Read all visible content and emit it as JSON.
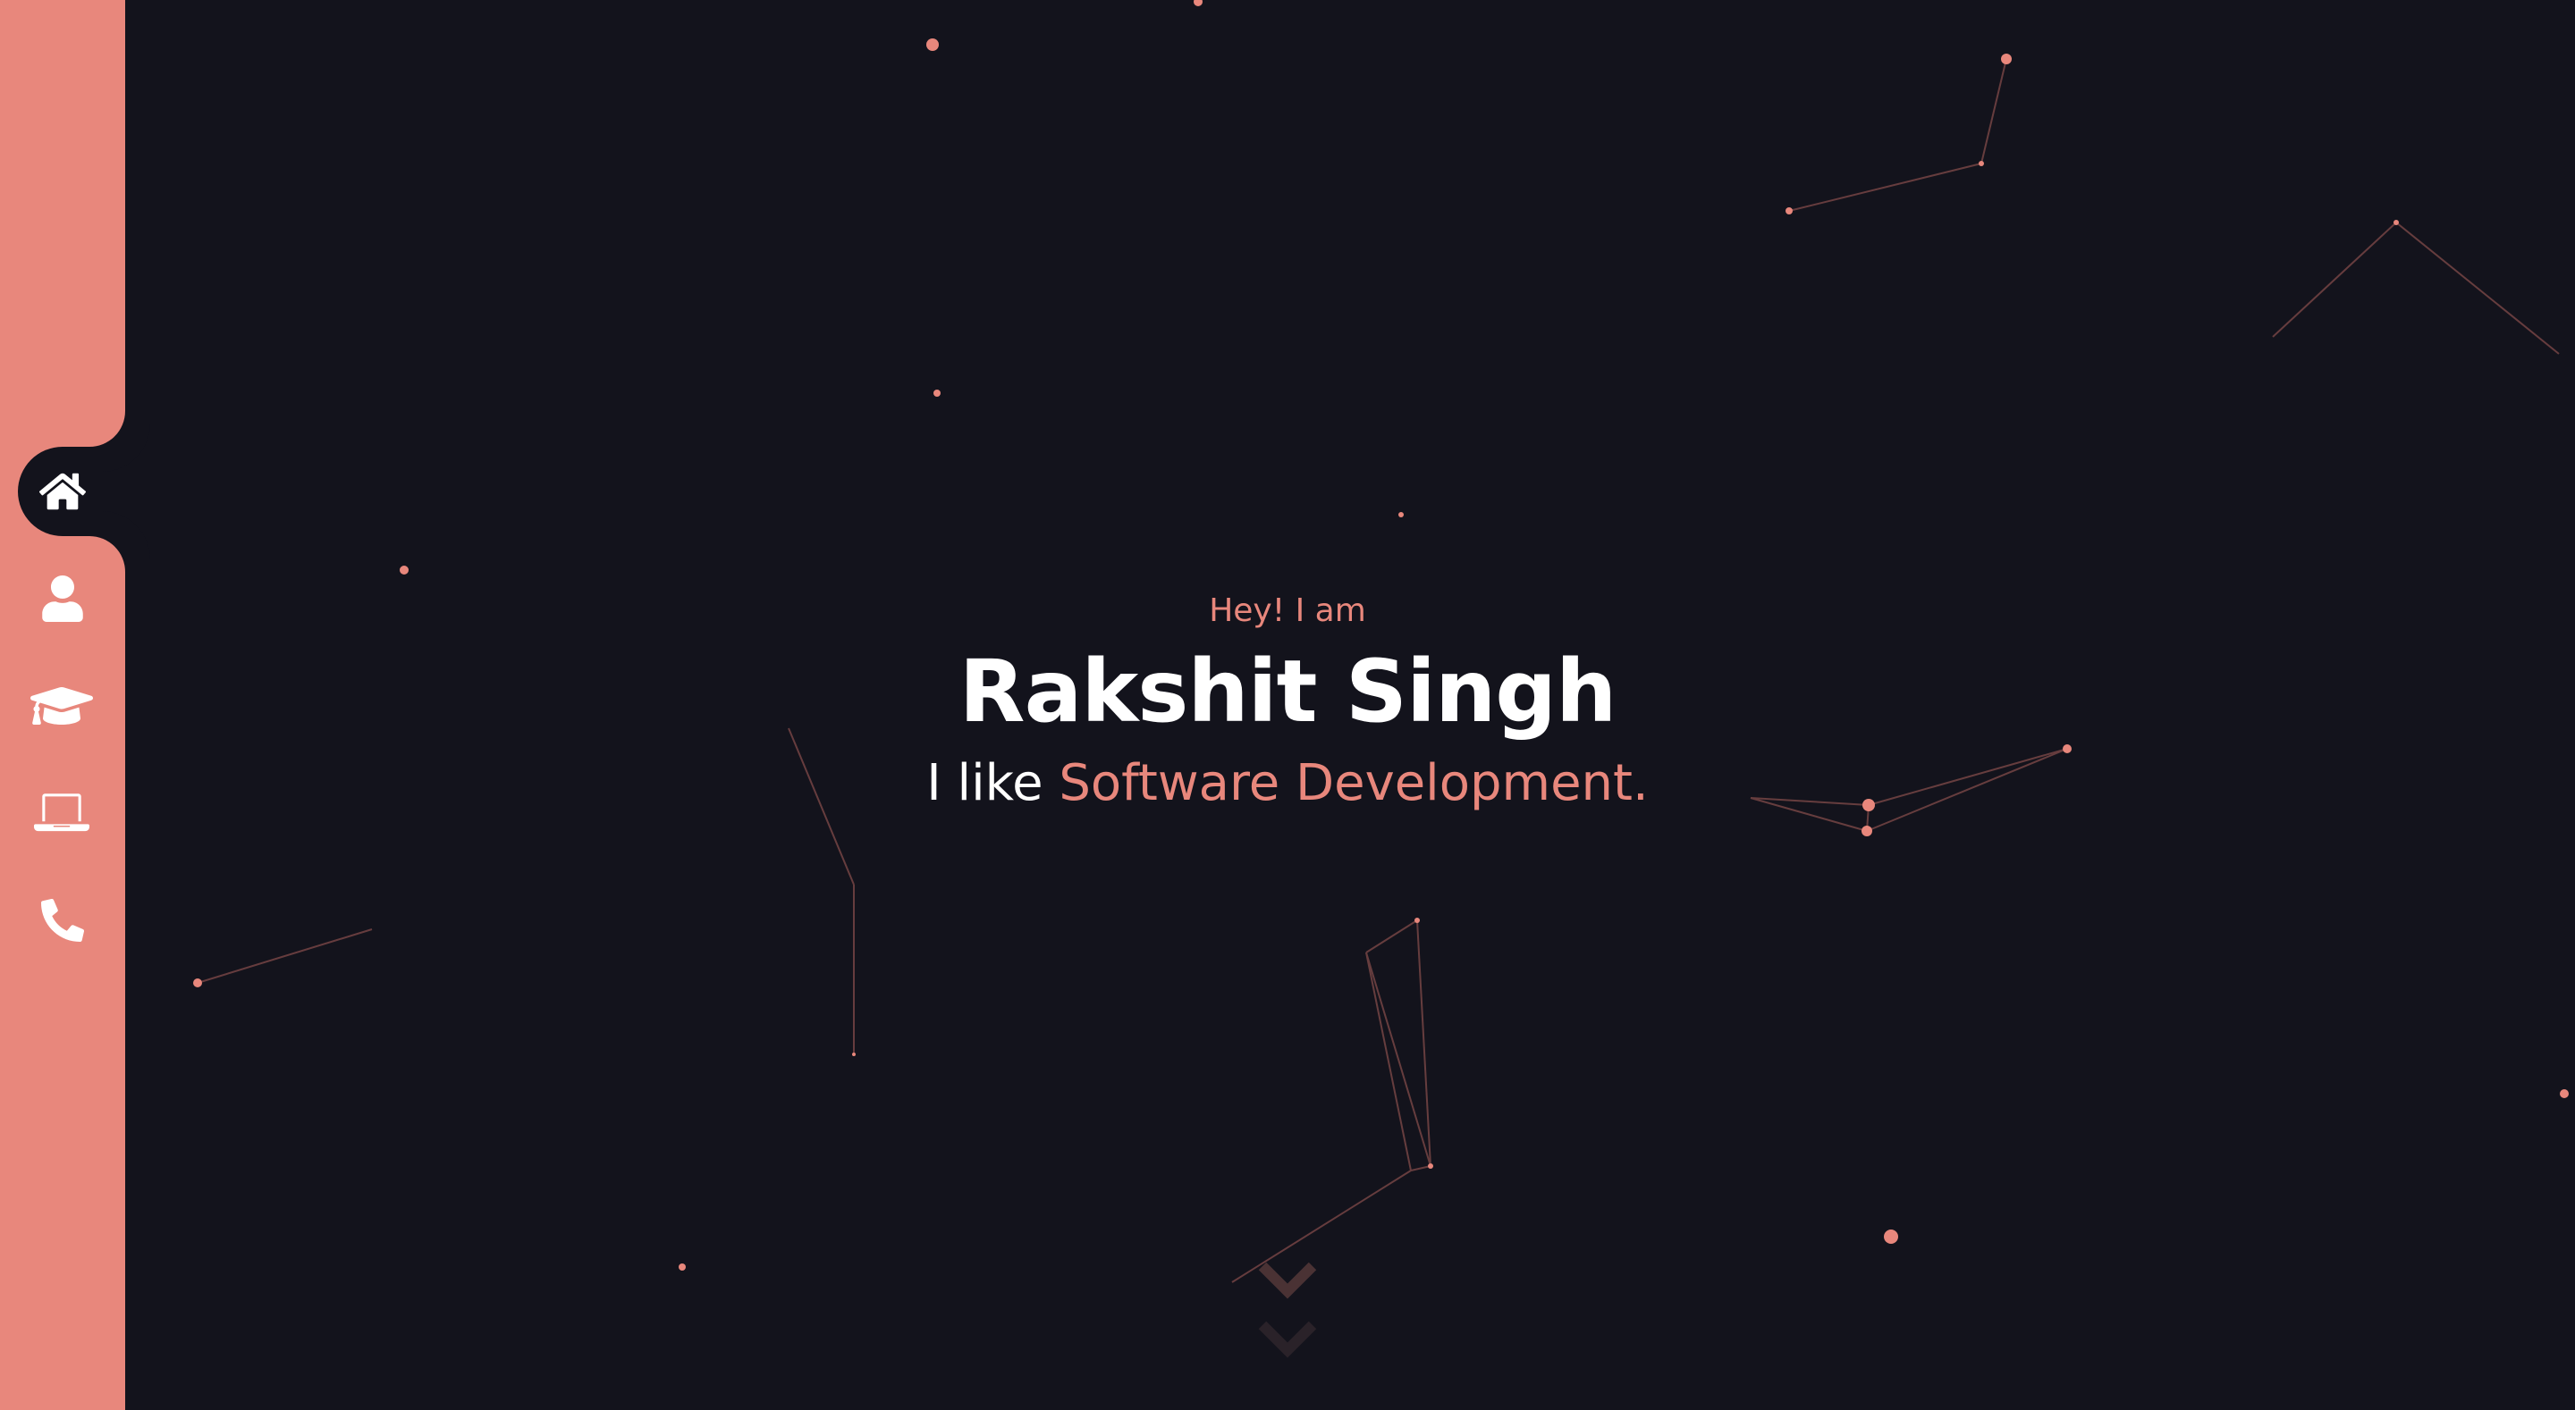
{
  "sidebar": {
    "items": [
      {
        "icon": "home-icon",
        "active": true
      },
      {
        "icon": "user-icon",
        "active": false
      },
      {
        "icon": "graduation-cap-icon",
        "active": false
      },
      {
        "icon": "laptop-icon",
        "active": false
      },
      {
        "icon": "phone-icon",
        "active": false
      }
    ]
  },
  "hero": {
    "greeting": "Hey! I am",
    "name": "Rakshit Singh",
    "tagline_prefix": "I like",
    "tagline_highlight": "Software Development."
  },
  "colors": {
    "accent": "#e8877c",
    "background": "#13131c",
    "text": "#ffffff"
  }
}
